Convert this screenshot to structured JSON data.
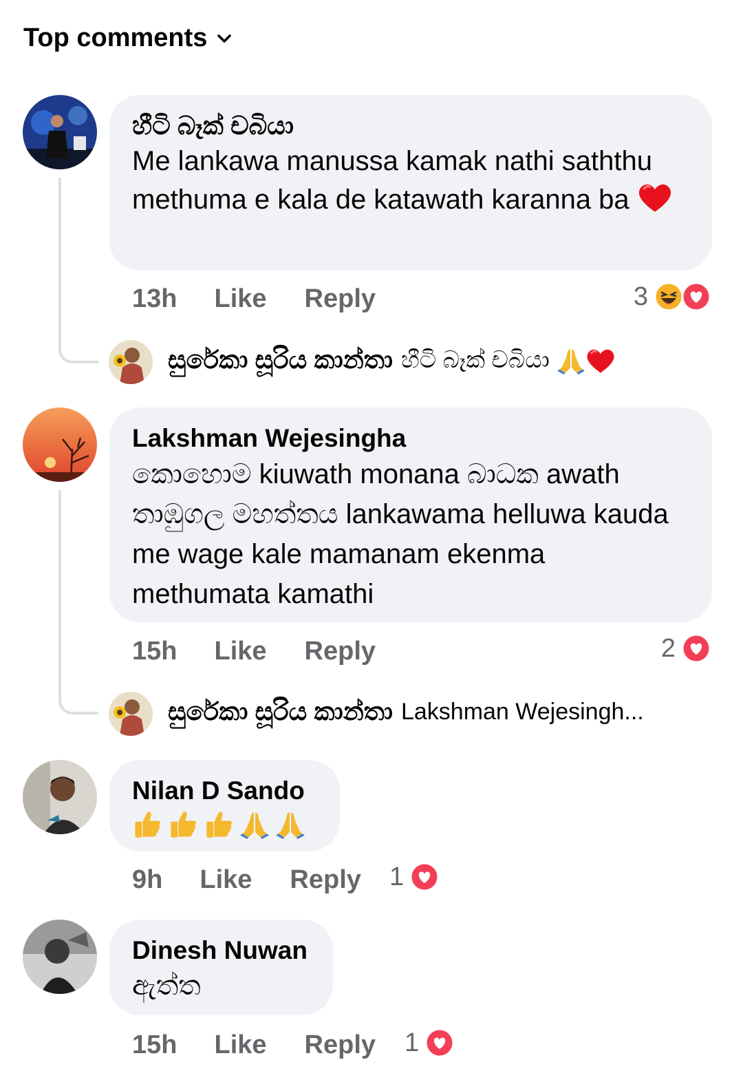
{
  "header": {
    "sort_label": "Top comments",
    "sort_icon": "chevron-down-icon"
  },
  "comments": [
    {
      "author": "හීටි බෑක් චබියා",
      "text": "Me lankawa manussa kamak nathi saththu methuma e kala de katawath karanna ba",
      "time": "13h",
      "like_label": "Like",
      "reply_label": "Reply",
      "reaction_count": "3",
      "reactions": [
        "haha-icon",
        "love-icon"
      ],
      "reply": {
        "author": "සුරේකා සූරිය කාන්තා",
        "text": "හීටි බෑක් චබියා",
        "emojis": [
          "folded-hands-icon",
          "red-heart-icon"
        ]
      }
    },
    {
      "author": "Lakshman Wejesingha",
      "text": "කොහොම  kiuwath monana බාධක awath තාඹුගල මහත්තය lankawama helluwa kauda me wage kale mamanam ekenma methumata kamathi",
      "time": "15h",
      "like_label": "Like",
      "reply_label": "Reply",
      "reaction_count": "2",
      "reactions": [
        "love-icon"
      ],
      "reply": {
        "author": "සුරේකා සූරිය කාන්තා",
        "text": "Lakshman Wejesingh..."
      }
    },
    {
      "author": "Nilan D Sando",
      "emojis": [
        "thumbs-up-icon",
        "thumbs-up-icon",
        "thumbs-up-icon",
        "folded-hands-icon",
        "folded-hands-icon"
      ],
      "time": "9h",
      "like_label": "Like",
      "reply_label": "Reply",
      "reaction_count": "1",
      "reactions": [
        "love-icon"
      ]
    },
    {
      "author": "Dinesh Nuwan",
      "text": "ඇත්ත",
      "time": "15h",
      "like_label": "Like",
      "reply_label": "Reply",
      "reaction_count": "1",
      "reactions": [
        "love-icon"
      ]
    }
  ],
  "colors": {
    "bubble": "#f0f2f5",
    "meta_text": "#65676b",
    "love": "#f33e58",
    "haha": "#f7b125",
    "thread_line": "#dcdee3"
  }
}
